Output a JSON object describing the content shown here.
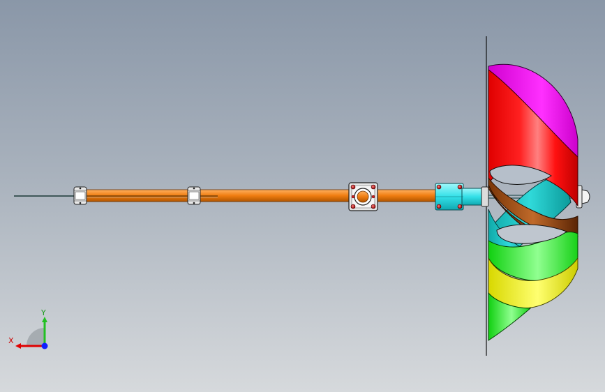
{
  "viewport": {
    "background_top": "#8a97a8",
    "background_bottom": "#d6d9dc"
  },
  "model": {
    "parts": [
      {
        "name": "shaft",
        "color": "#f07d10"
      },
      {
        "name": "coupling-housing",
        "color": "#33e0e8"
      },
      {
        "name": "helical-blade-top",
        "color": "#ee00ee"
      },
      {
        "name": "helical-blade-red",
        "color": "#ff0000"
      },
      {
        "name": "helical-blade-cyan",
        "color": "#1ac6c6"
      },
      {
        "name": "helical-blade-brown",
        "color": "#9b4a12"
      },
      {
        "name": "helical-blade-green",
        "color": "#22ee22"
      },
      {
        "name": "helical-blade-yellow",
        "color": "#e5e500"
      }
    ]
  },
  "triad": {
    "x_label": "X",
    "y_label": "Y",
    "x_color": "#e00000",
    "y_color": "#22c022",
    "z_color": "#1020ff"
  }
}
